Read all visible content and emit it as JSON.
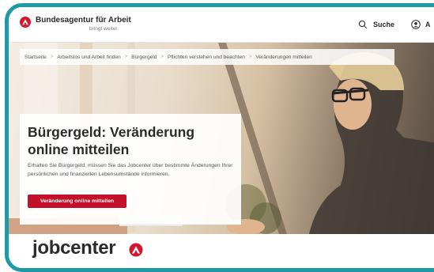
{
  "header": {
    "brand_name": "Bundesagentur für Arbeit",
    "brand_tagline": "bringt weiter.",
    "search_label": "Suche",
    "user_label": "A"
  },
  "breadcrumb": [
    "Startseite",
    "Arbeitslos und Arbeit finden",
    "Bürgergeld",
    "Pflichten verstehen und beachten",
    "Veränderungen mitteilen"
  ],
  "hero": {
    "title": "Bürgergeld: Veränderung online mitteilen",
    "description": "Erhalten Sie Bürgergeld, müssen Sie das Jobcenter über bestimmte Änderungen Ihrer persönlichen und finanziellen Lebensumstände informieren.",
    "cta_label": "Veränderung online mitteilen"
  },
  "jobcenter": {
    "wordmark": "jobcenter"
  },
  "colors": {
    "frame": "#1e9aa6",
    "brand_red": "#c2102b",
    "text_dark": "#2b2b2b"
  },
  "icons": [
    "ba-logo-icon",
    "search-icon",
    "user-icon",
    "jobcenter-logo-icon"
  ]
}
